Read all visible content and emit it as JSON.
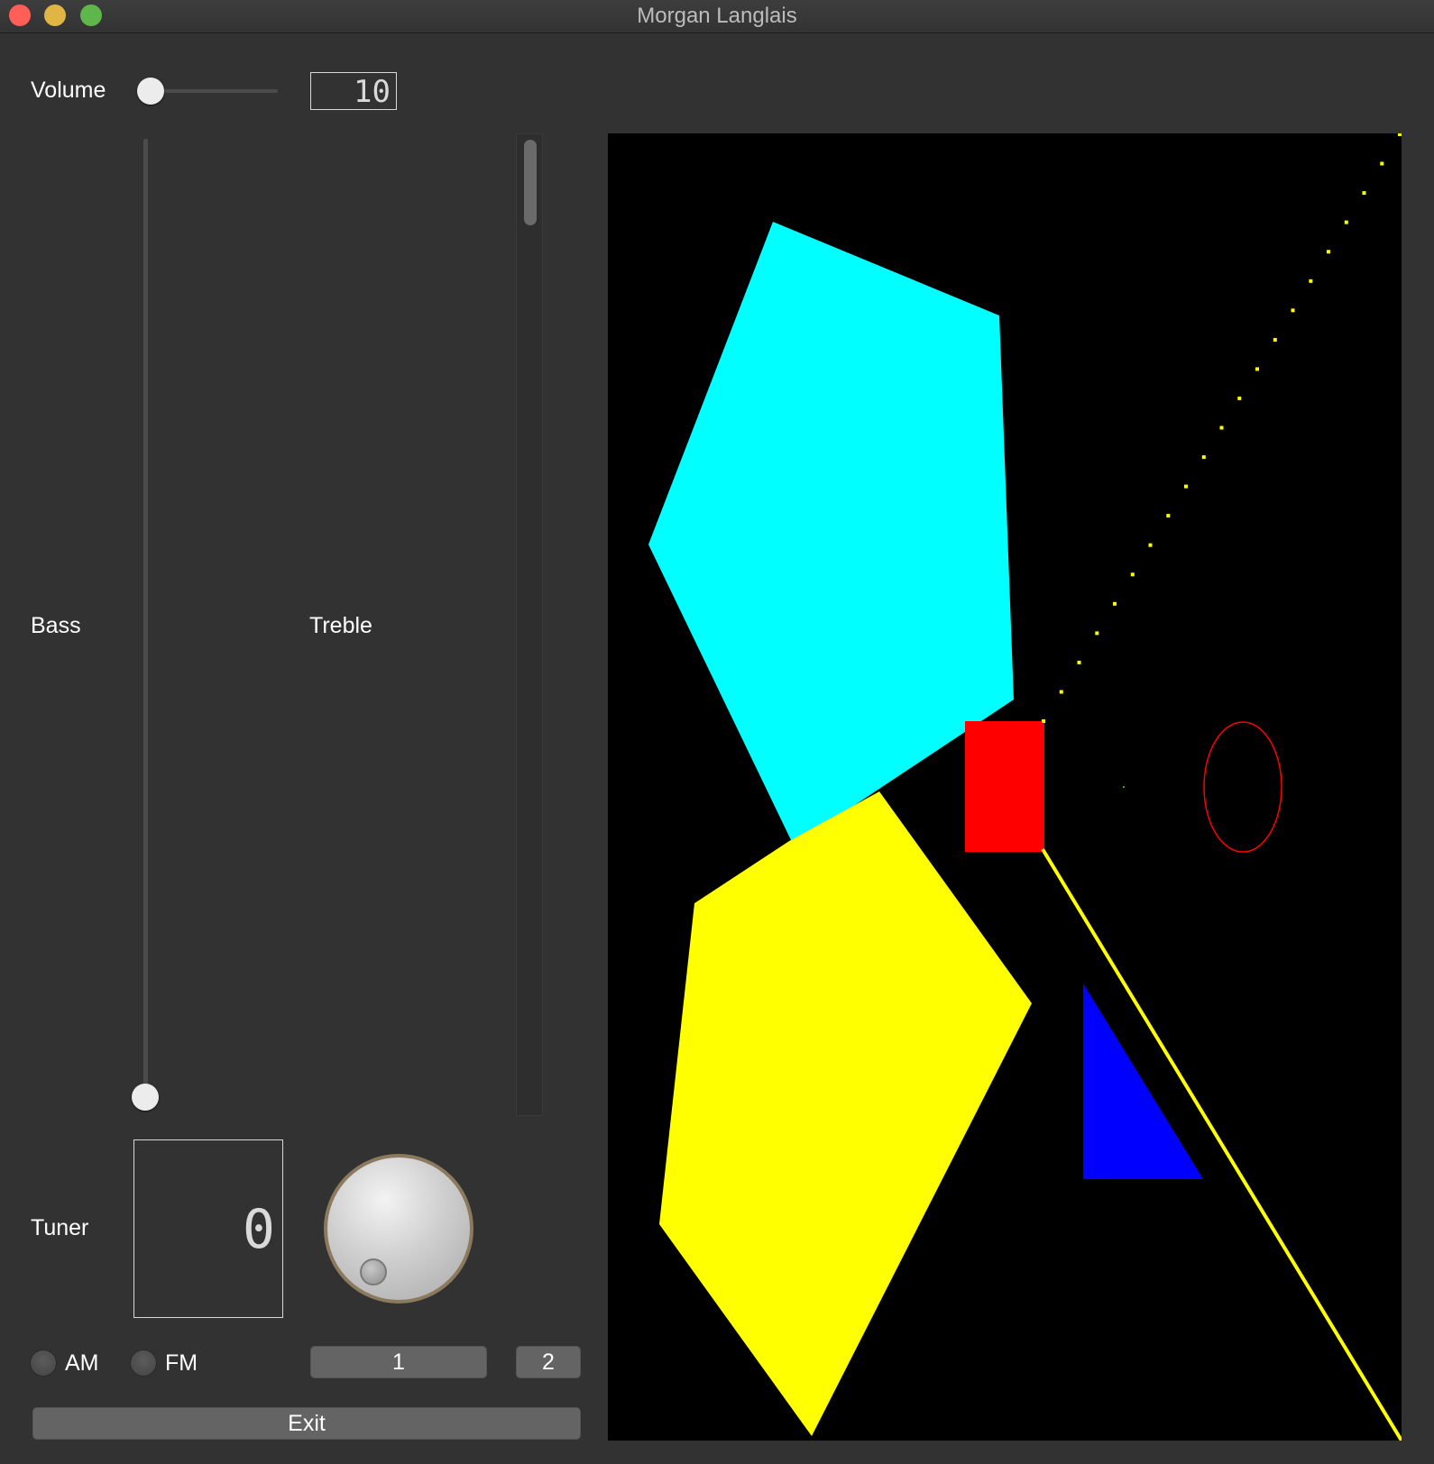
{
  "window": {
    "title": "Morgan Langlais"
  },
  "volume": {
    "label": "Volume",
    "lcd_value": "10",
    "level": 0
  },
  "bass": {
    "label": "Bass",
    "level": 0
  },
  "treble": {
    "label": "Treble"
  },
  "tuner": {
    "label": "Tuner",
    "lcd_value": "0"
  },
  "band": {
    "am_label": "AM",
    "fm_label": "FM"
  },
  "buttons": {
    "preset_1": "1",
    "preset_2": "2",
    "exit": "Exit"
  },
  "canvas": {
    "colors": {
      "cyan_polygon": "#00ffff",
      "yellow_polygon": "#ffff00",
      "red_rectangle": "#ff0000",
      "red_ellipse_outline": "#ff0000",
      "blue_triangle": "#0000ff",
      "yellow_line": "#ffff00",
      "background": "#000000"
    }
  }
}
